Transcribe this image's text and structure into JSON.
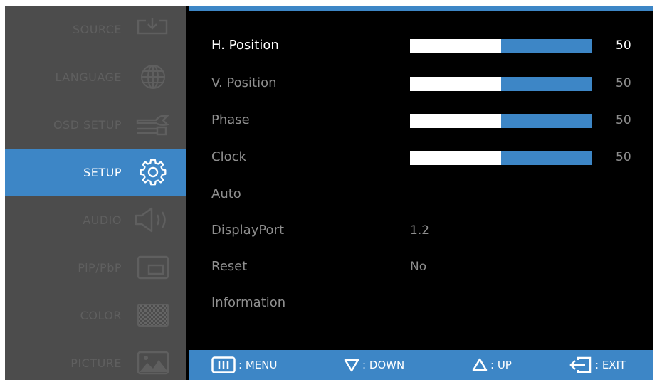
{
  "sidebar": {
    "items": [
      {
        "label": "SOURCE",
        "icon": "source-input-icon"
      },
      {
        "label": "LANGUAGE",
        "icon": "globe-icon"
      },
      {
        "label": "OSD SETUP",
        "icon": "wrench-icon"
      },
      {
        "label": "SETUP",
        "icon": "gear-icon",
        "active": true
      },
      {
        "label": "AUDIO",
        "icon": "speaker-icon"
      },
      {
        "label": "PiP/PbP",
        "icon": "pip-icon"
      },
      {
        "label": "COLOR",
        "icon": "color-grid-icon"
      },
      {
        "label": "PICTURE",
        "icon": "picture-icon"
      }
    ]
  },
  "setup": {
    "rows": [
      {
        "label": "H. Position",
        "level": 0.5,
        "value": "50"
      },
      {
        "label": "V. Position",
        "level": 0.5,
        "value": "50"
      },
      {
        "label": "Phase",
        "level": 0.5,
        "value": "50"
      },
      {
        "label": "Clock",
        "level": 0.5,
        "value": "50"
      },
      {
        "label": "Auto"
      },
      {
        "label": "DisplayPort",
        "value": "1.2"
      },
      {
        "label": "Reset",
        "value": "No"
      },
      {
        "label": "Information"
      }
    ]
  },
  "footer": {
    "menu": ": MENU",
    "down": ": DOWN",
    "up": ": UP",
    "exit": ": EXIT"
  },
  "colors": {
    "accent": "#3d86c6",
    "sidebar_bg": "#4c4c4c",
    "content_bg": "#000000"
  }
}
